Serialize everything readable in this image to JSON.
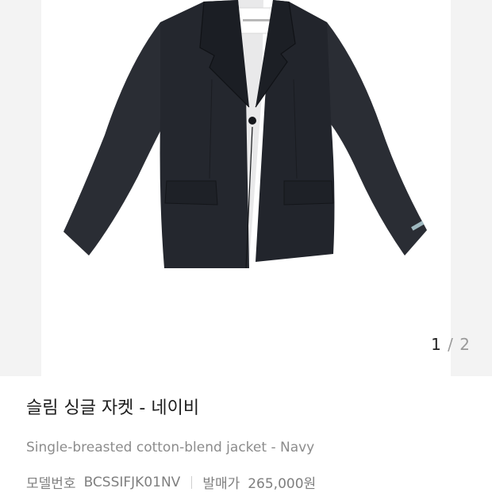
{
  "product": {
    "title": "슬림 싱글 자켓 - 네이비",
    "subtitle": "Single-breasted cotton-blend jacket - Navy",
    "model_label": "모델번호",
    "model_value": "BCSSIFJK01NV",
    "price_label": "발매가",
    "price_value": "265,000원"
  },
  "gallery": {
    "current": "1",
    "separator": "/",
    "total": "2",
    "image_icon": "navy-jacket-photo"
  },
  "colors": {
    "jacket": "#23262d",
    "gallery_bg": "#f3f3f3",
    "muted_text": "#8c8c8c"
  }
}
